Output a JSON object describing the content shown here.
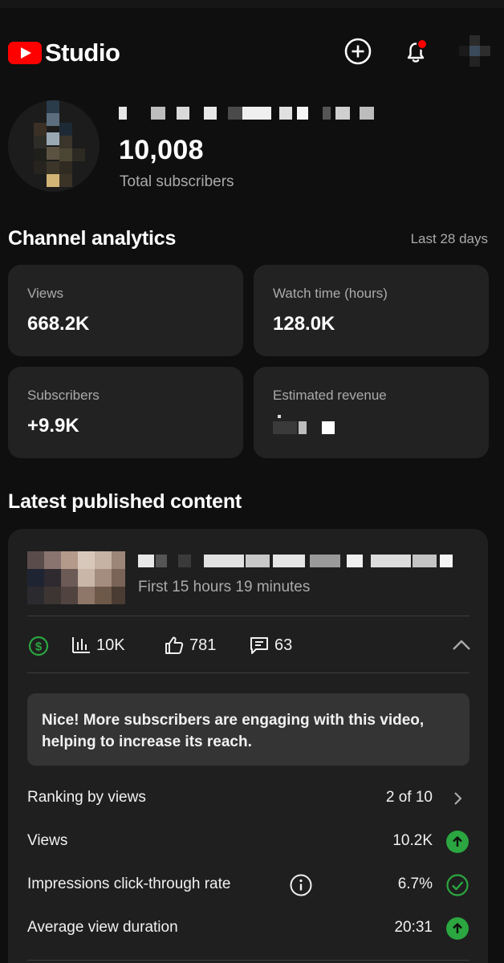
{
  "header": {
    "logo_text": "Studio",
    "create_icon": "plus-circle-icon",
    "notifications_icon": "bell-icon",
    "notification_dot_color": "#ff0000"
  },
  "channel": {
    "subscriber_count": "10,008",
    "subscriber_label": "Total subscribers"
  },
  "analytics": {
    "title": "Channel analytics",
    "range": "Last 28 days",
    "cards": [
      {
        "label": "Views",
        "value": "668.2K"
      },
      {
        "label": "Watch time (hours)",
        "value": "128.0K"
      },
      {
        "label": "Subscribers",
        "value": "+9.9K"
      },
      {
        "label": "Estimated revenue",
        "value": ""
      }
    ]
  },
  "latest": {
    "title": "Latest published content",
    "video": {
      "subtitle": "First 15 hours 19 minutes",
      "stats": {
        "monetization_icon": "dollar-circle-icon",
        "views": "10K",
        "likes": "781",
        "comments": "63"
      },
      "insight": "Nice! More subscribers are engaging with this video, helping to increase its reach.",
      "metrics": [
        {
          "label": "Ranking by views",
          "value": "2 of 10",
          "icon": "chevron-right-icon"
        },
        {
          "label": "Views",
          "value": "10.2K",
          "icon": "arrow-up-circle-icon"
        },
        {
          "label": "Impressions click-through rate",
          "value": "6.7%",
          "icon": "check-circle-icon"
        },
        {
          "label": "Average view duration",
          "value": "20:31",
          "icon": "arrow-up-circle-icon"
        }
      ]
    }
  },
  "colors": {
    "background": "#0f0f0f",
    "card": "#222222",
    "accent_red": "#ff0000",
    "positive_green": "#2ba640"
  }
}
